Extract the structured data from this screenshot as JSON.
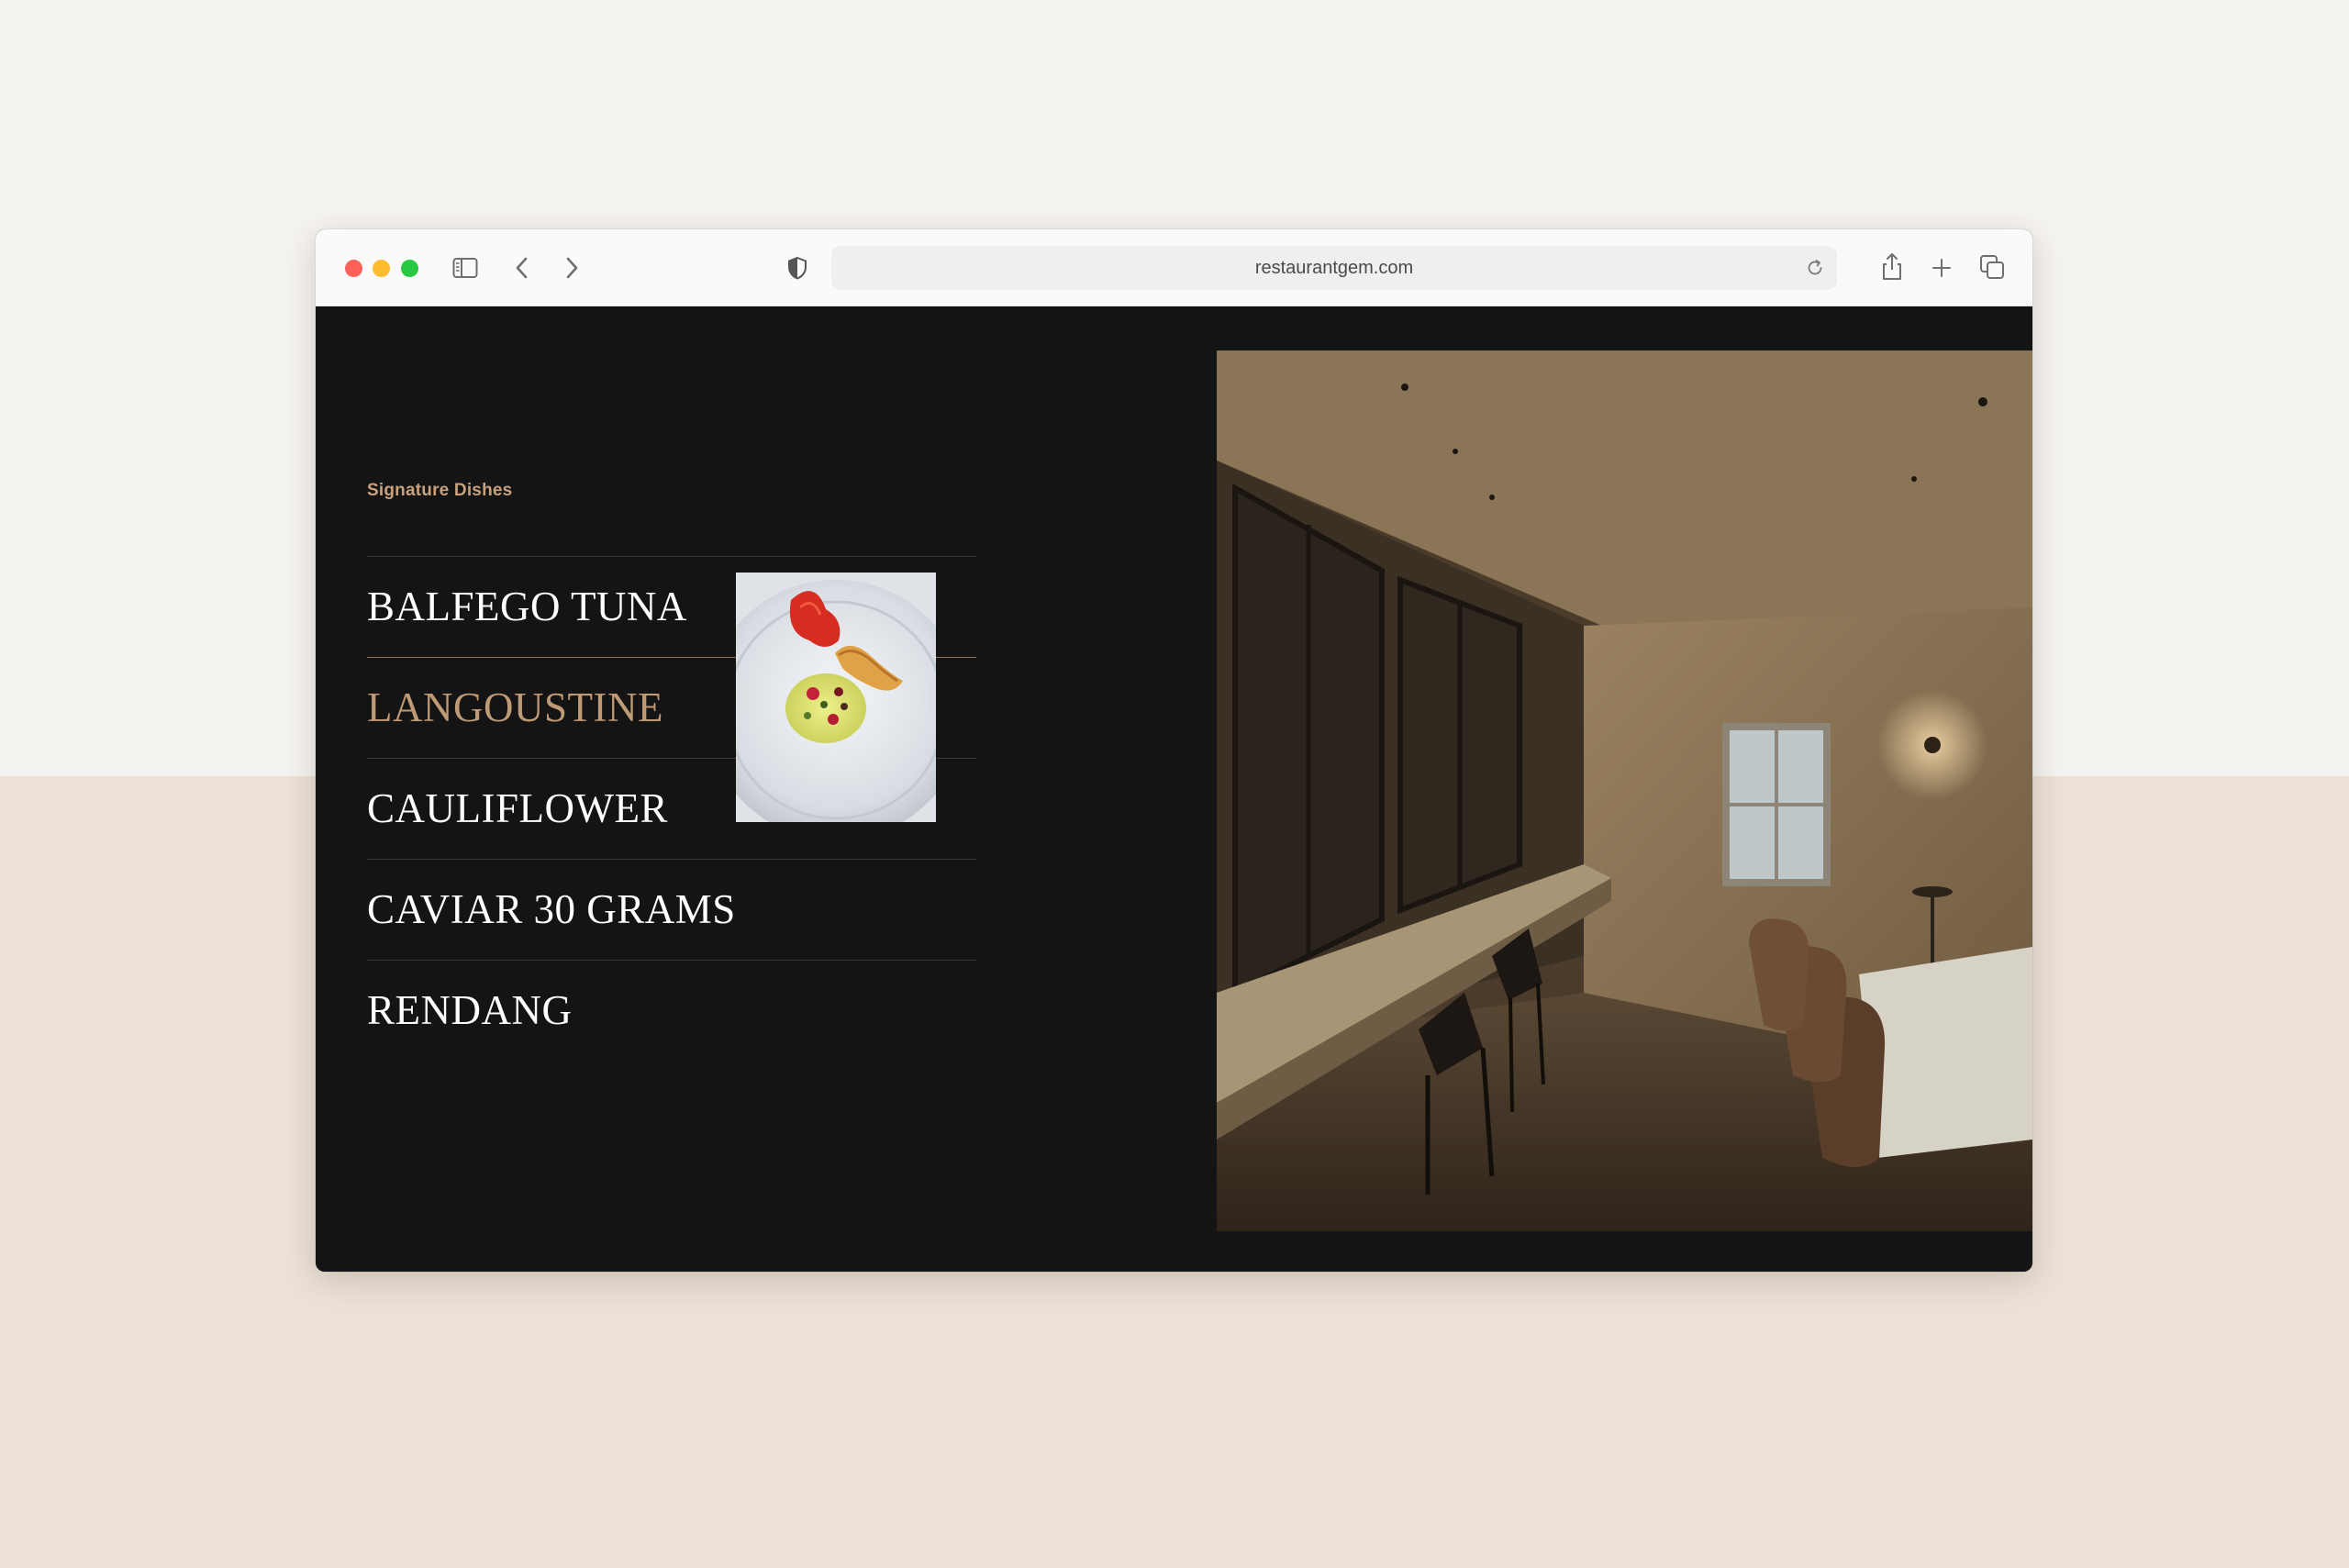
{
  "browser": {
    "url": "restaurantgem.com",
    "icons": [
      "close-dot",
      "minimize-dot",
      "zoom-dot",
      "sidebar-icon",
      "back-icon",
      "forward-icon",
      "shield-icon",
      "reload-icon",
      "share-icon",
      "new-tab-icon",
      "tabs-overview-icon"
    ]
  },
  "page": {
    "section_label": "Signature Dishes",
    "dishes": [
      {
        "name": "BALFEGO TUNA",
        "active": false
      },
      {
        "name": "LANGOUSTINE",
        "active": true
      },
      {
        "name": "CAULIFLOWER",
        "active": false
      },
      {
        "name": "CAVIAR 30 GRAMS",
        "active": false
      },
      {
        "name": "RENDANG",
        "active": false
      }
    ],
    "colors": {
      "accent": "#bf9a76",
      "label": "#c9a27d",
      "page_background": "#141414",
      "backdrop_top": "#f5f3ef",
      "backdrop_bottom": "#ebe1d6"
    }
  }
}
